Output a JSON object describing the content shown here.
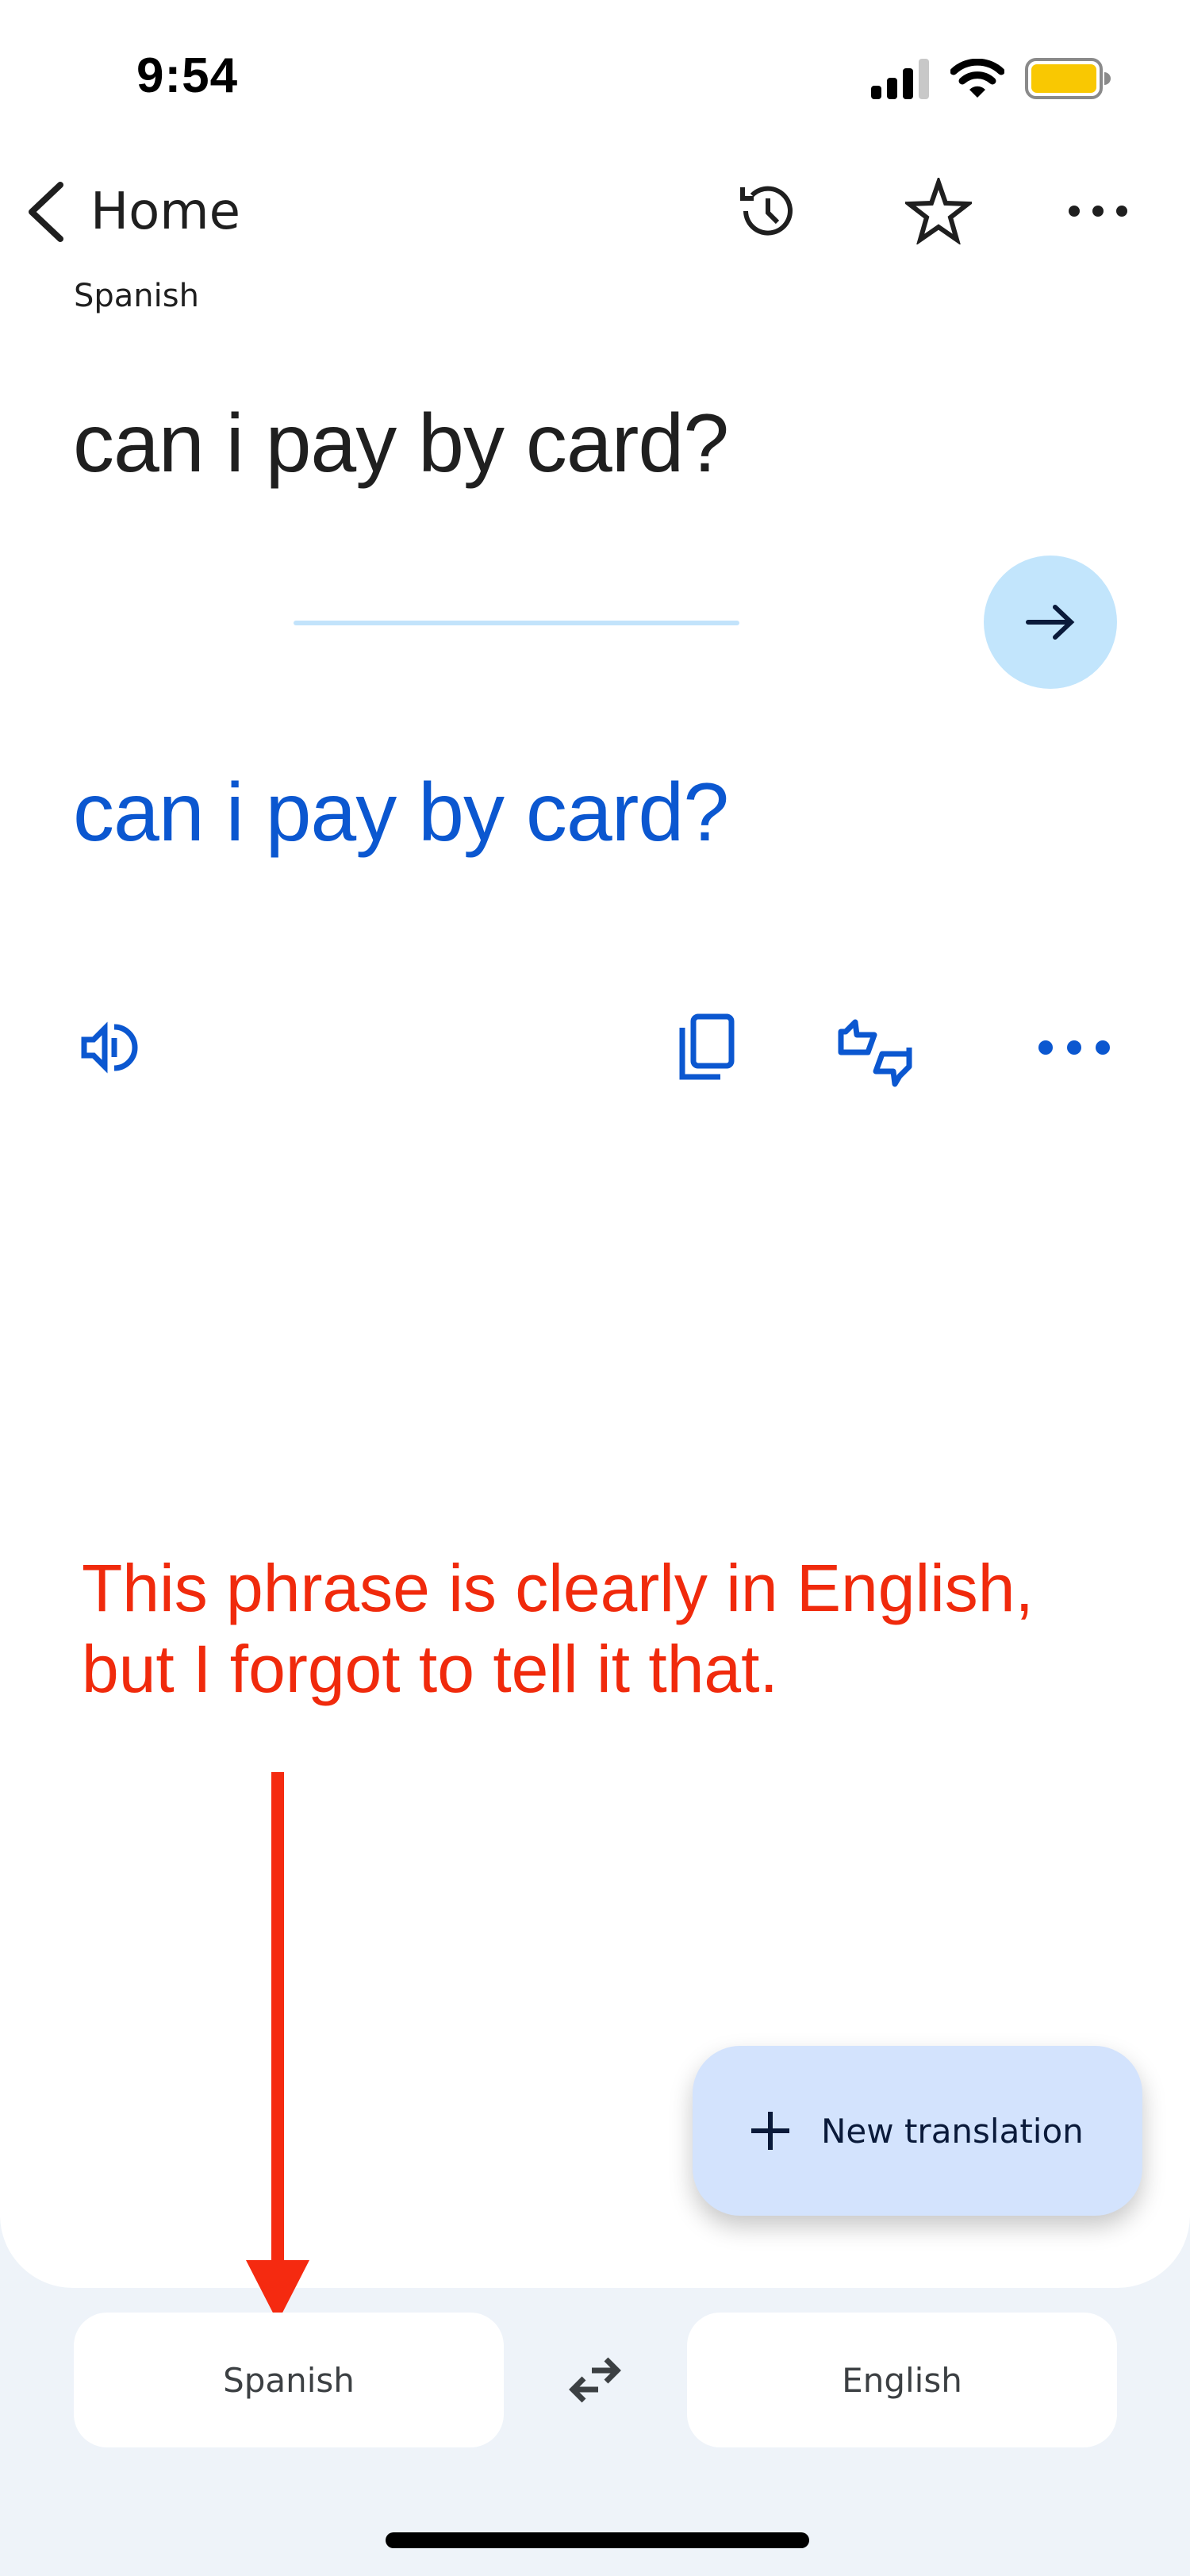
{
  "status_bar": {
    "time": "9:54",
    "icons": [
      "signal-icon",
      "wifi-icon",
      "battery-icon"
    ],
    "battery_color": "#f9c802"
  },
  "nav": {
    "back_label": "Home",
    "actions": [
      "history-icon",
      "star-icon",
      "more-icon"
    ]
  },
  "source": {
    "language_label": "Spanish",
    "text": "can i pay by card?"
  },
  "translation": {
    "text": "can i pay by card?",
    "actions": [
      "speaker-icon",
      "copy-icon",
      "feedback-icon",
      "more-icon"
    ],
    "color": "#0b57d0"
  },
  "annotation": {
    "line1": "This phrase is clearly in English,",
    "line2": "but I forgot to tell it that.",
    "color": "#f02a0c"
  },
  "fab": {
    "label": "New translation"
  },
  "language_bar": {
    "source_language": "Spanish",
    "target_language": "English"
  }
}
